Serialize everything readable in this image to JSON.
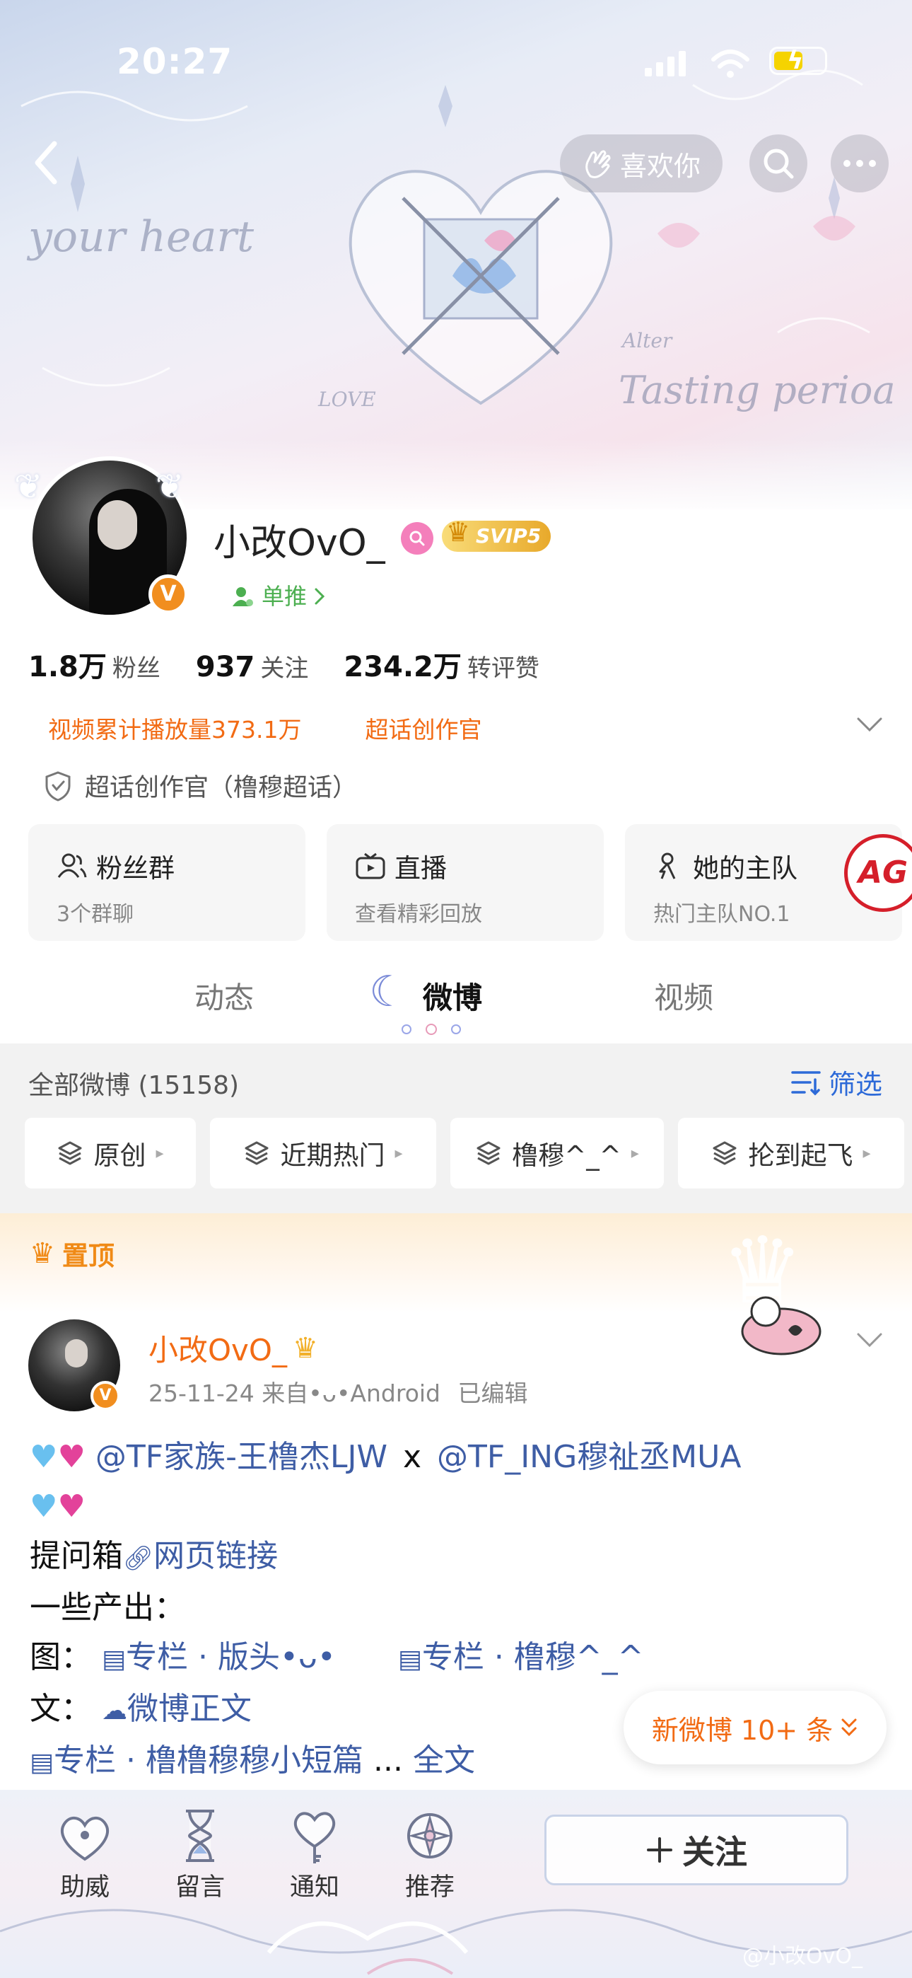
{
  "status_bar": {
    "time": "20:27"
  },
  "header": {
    "like_label": "喜欢你",
    "banner_texts": [
      "your heart",
      "Tasting perioa",
      "LOVE",
      "Alter"
    ]
  },
  "profile": {
    "name": "小改OvO_",
    "svip_label": "SVIP5",
    "tag_label": "单推",
    "stats": [
      {
        "num": "1.8万",
        "label": "粉丝"
      },
      {
        "num": "937",
        "label": "关注"
      },
      {
        "num": "234.2万",
        "label": "转评赞"
      }
    ],
    "honors": [
      "视频累计播放量373.1万",
      "超话创作官"
    ],
    "super_role": "超话创作官（橹穆超话）",
    "cards": [
      {
        "title": "粉丝群",
        "sub": "3个群聊",
        "icon": "group-icon"
      },
      {
        "title": "直播",
        "sub": "查看精彩回放",
        "icon": "tv-icon"
      },
      {
        "title": "她的主队",
        "sub": "热门主队NO.1",
        "icon": "team-icon",
        "logo": "AG"
      }
    ]
  },
  "tabs": [
    {
      "label": "动态",
      "active": false
    },
    {
      "label": "微博",
      "active": true
    },
    {
      "label": "视频",
      "active": false
    }
  ],
  "feed": {
    "header": "全部微博 (15158)",
    "filter_label": "筛选",
    "chips": [
      "原创",
      "近期热门",
      "橹穆^_^",
      "抡到起飞"
    ],
    "pinned_label": "置顶"
  },
  "post": {
    "author": "小改OvO_",
    "date": "25-11-24",
    "source": "来自•ᴗ•Android",
    "edited": "已编辑",
    "mention1": "@TF家族-王橹杰LJW",
    "x": "x",
    "mention2": "@TF_ING穆祉丞MUA",
    "question_box_prefix": "提问箱",
    "question_box_link": "网页链接",
    "output_title": "一些产出：",
    "pic_prefix": "图：",
    "pic_link1": "专栏 · 版头•ᴗ•",
    "pic_link2": "专栏 · 橹穆^_^",
    "text_prefix": "文：",
    "text_link": "微博正文",
    "column_link": "专栏 · 橹橹穆穆小短篇",
    "ellipsis": "...",
    "full_text": "全文"
  },
  "new_posts_label": "新微博 10+ 条",
  "bottom_nav": [
    {
      "label": "助威",
      "icon": "heart-lock-icon"
    },
    {
      "label": "留言",
      "icon": "hourglass-icon"
    },
    {
      "label": "通知",
      "icon": "heart-key-icon"
    },
    {
      "label": "推荐",
      "icon": "compass-icon"
    }
  ],
  "follow_label": "关注",
  "watermark": "@小改OvO_",
  "colors": {
    "accent_orange": "#f26b14",
    "link_blue": "#3e5da5",
    "filter_blue": "#2d6ad8",
    "verified_orange": "#f18e1f"
  }
}
